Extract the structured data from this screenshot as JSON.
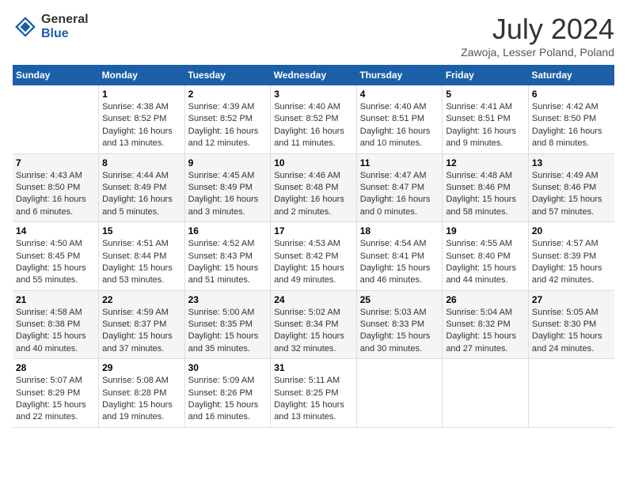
{
  "header": {
    "logo_general": "General",
    "logo_blue": "Blue",
    "month_year": "July 2024",
    "location": "Zawoja, Lesser Poland, Poland"
  },
  "calendar": {
    "days_of_week": [
      "Sunday",
      "Monday",
      "Tuesday",
      "Wednesday",
      "Thursday",
      "Friday",
      "Saturday"
    ],
    "weeks": [
      [
        {
          "day": "",
          "info": ""
        },
        {
          "day": "1",
          "info": "Sunrise: 4:38 AM\nSunset: 8:52 PM\nDaylight: 16 hours and 13 minutes."
        },
        {
          "day": "2",
          "info": "Sunrise: 4:39 AM\nSunset: 8:52 PM\nDaylight: 16 hours and 12 minutes."
        },
        {
          "day": "3",
          "info": "Sunrise: 4:40 AM\nSunset: 8:52 PM\nDaylight: 16 hours and 11 minutes."
        },
        {
          "day": "4",
          "info": "Sunrise: 4:40 AM\nSunset: 8:51 PM\nDaylight: 16 hours and 10 minutes."
        },
        {
          "day": "5",
          "info": "Sunrise: 4:41 AM\nSunset: 8:51 PM\nDaylight: 16 hours and 9 minutes."
        },
        {
          "day": "6",
          "info": "Sunrise: 4:42 AM\nSunset: 8:50 PM\nDaylight: 16 hours and 8 minutes."
        }
      ],
      [
        {
          "day": "7",
          "info": "Sunrise: 4:43 AM\nSunset: 8:50 PM\nDaylight: 16 hours and 6 minutes."
        },
        {
          "day": "8",
          "info": "Sunrise: 4:44 AM\nSunset: 8:49 PM\nDaylight: 16 hours and 5 minutes."
        },
        {
          "day": "9",
          "info": "Sunrise: 4:45 AM\nSunset: 8:49 PM\nDaylight: 16 hours and 3 minutes."
        },
        {
          "day": "10",
          "info": "Sunrise: 4:46 AM\nSunset: 8:48 PM\nDaylight: 16 hours and 2 minutes."
        },
        {
          "day": "11",
          "info": "Sunrise: 4:47 AM\nSunset: 8:47 PM\nDaylight: 16 hours and 0 minutes."
        },
        {
          "day": "12",
          "info": "Sunrise: 4:48 AM\nSunset: 8:46 PM\nDaylight: 15 hours and 58 minutes."
        },
        {
          "day": "13",
          "info": "Sunrise: 4:49 AM\nSunset: 8:46 PM\nDaylight: 15 hours and 57 minutes."
        }
      ],
      [
        {
          "day": "14",
          "info": "Sunrise: 4:50 AM\nSunset: 8:45 PM\nDaylight: 15 hours and 55 minutes."
        },
        {
          "day": "15",
          "info": "Sunrise: 4:51 AM\nSunset: 8:44 PM\nDaylight: 15 hours and 53 minutes."
        },
        {
          "day": "16",
          "info": "Sunrise: 4:52 AM\nSunset: 8:43 PM\nDaylight: 15 hours and 51 minutes."
        },
        {
          "day": "17",
          "info": "Sunrise: 4:53 AM\nSunset: 8:42 PM\nDaylight: 15 hours and 49 minutes."
        },
        {
          "day": "18",
          "info": "Sunrise: 4:54 AM\nSunset: 8:41 PM\nDaylight: 15 hours and 46 minutes."
        },
        {
          "day": "19",
          "info": "Sunrise: 4:55 AM\nSunset: 8:40 PM\nDaylight: 15 hours and 44 minutes."
        },
        {
          "day": "20",
          "info": "Sunrise: 4:57 AM\nSunset: 8:39 PM\nDaylight: 15 hours and 42 minutes."
        }
      ],
      [
        {
          "day": "21",
          "info": "Sunrise: 4:58 AM\nSunset: 8:38 PM\nDaylight: 15 hours and 40 minutes."
        },
        {
          "day": "22",
          "info": "Sunrise: 4:59 AM\nSunset: 8:37 PM\nDaylight: 15 hours and 37 minutes."
        },
        {
          "day": "23",
          "info": "Sunrise: 5:00 AM\nSunset: 8:35 PM\nDaylight: 15 hours and 35 minutes."
        },
        {
          "day": "24",
          "info": "Sunrise: 5:02 AM\nSunset: 8:34 PM\nDaylight: 15 hours and 32 minutes."
        },
        {
          "day": "25",
          "info": "Sunrise: 5:03 AM\nSunset: 8:33 PM\nDaylight: 15 hours and 30 minutes."
        },
        {
          "day": "26",
          "info": "Sunrise: 5:04 AM\nSunset: 8:32 PM\nDaylight: 15 hours and 27 minutes."
        },
        {
          "day": "27",
          "info": "Sunrise: 5:05 AM\nSunset: 8:30 PM\nDaylight: 15 hours and 24 minutes."
        }
      ],
      [
        {
          "day": "28",
          "info": "Sunrise: 5:07 AM\nSunset: 8:29 PM\nDaylight: 15 hours and 22 minutes."
        },
        {
          "day": "29",
          "info": "Sunrise: 5:08 AM\nSunset: 8:28 PM\nDaylight: 15 hours and 19 minutes."
        },
        {
          "day": "30",
          "info": "Sunrise: 5:09 AM\nSunset: 8:26 PM\nDaylight: 15 hours and 16 minutes."
        },
        {
          "day": "31",
          "info": "Sunrise: 5:11 AM\nSunset: 8:25 PM\nDaylight: 15 hours and 13 minutes."
        },
        {
          "day": "",
          "info": ""
        },
        {
          "day": "",
          "info": ""
        },
        {
          "day": "",
          "info": ""
        }
      ]
    ]
  }
}
